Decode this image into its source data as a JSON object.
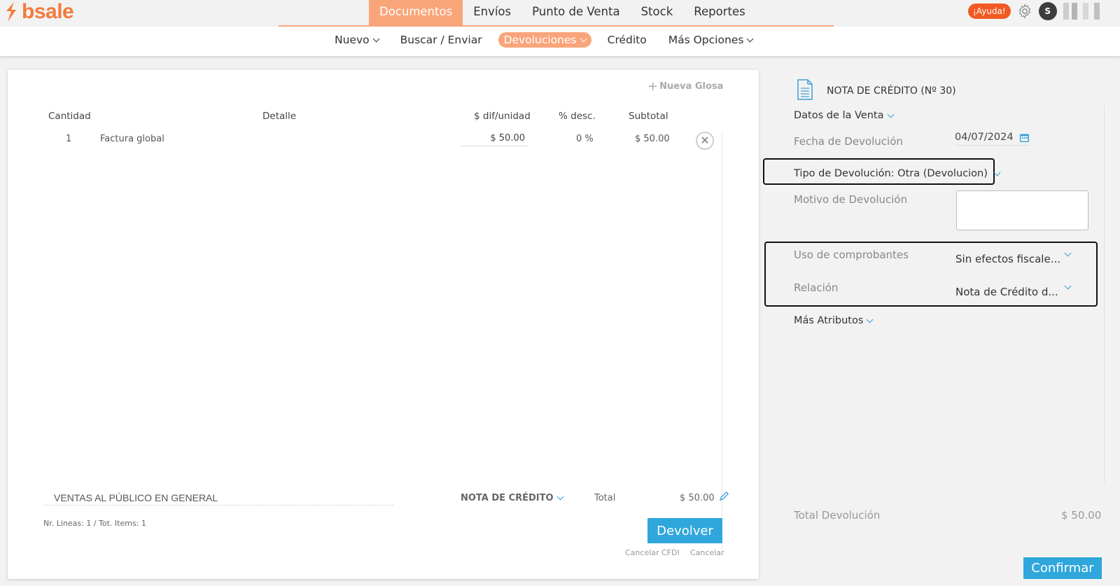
{
  "brand": {
    "name": "bsale",
    "color": "#f47b3b"
  },
  "main_nav": [
    {
      "label": "Documentos",
      "active": true
    },
    {
      "label": "Envíos"
    },
    {
      "label": "Punto de Venta"
    },
    {
      "label": "Stock"
    },
    {
      "label": "Reportes"
    }
  ],
  "top_right": {
    "help_label": "¡Ayuda!",
    "avatar_initial": "S"
  },
  "sub_nav": [
    {
      "label": "Nuevo",
      "dropdown": true
    },
    {
      "label": "Buscar / Enviar"
    },
    {
      "label": "Devoluciones",
      "dropdown": true,
      "active": true
    },
    {
      "label": "Crédito"
    },
    {
      "label": "Más Opciones",
      "dropdown": true
    }
  ],
  "editor": {
    "new_gloss_label": "Nueva Glosa",
    "columns": {
      "cantidad": "Cantidad",
      "detalle": "Detalle",
      "dif_unidad": "$ dif/unidad",
      "desc": "% desc.",
      "subtotal": "Subtotal"
    },
    "rows": [
      {
        "cantidad": "1",
        "detalle": "Factura global",
        "dif_unidad": "$ 50.00",
        "desc": "0 %",
        "subtotal": "$ 50.00"
      }
    ],
    "client_name": "VENTAS AL PÚBLICO  EN GENERAL",
    "doc_type": "NOTA DE CRÉDITO",
    "total_label": "Total",
    "total_value": "$ 50.00",
    "summary": "Nr. Lineas: 1 / Tot. Items: 1",
    "devolver_label": "Devolver",
    "cancel_cfdi_label": "Cancelar CFDI",
    "cancel_label": "Cancelar"
  },
  "sidebar": {
    "title": "NOTA DE CRÉDITO (Nº 30)",
    "datos_venta": "Datos de la Venta",
    "fecha_label": "Fecha de Devolución",
    "fecha_value": "04/07/2024",
    "tipo_label": "Tipo de Devolución: Otra (Devolucion)",
    "motivo_label": "Motivo de Devolución",
    "uso_label": "Uso de comprobantes",
    "uso_value": "Sin efectos fiscale...",
    "relacion_label": "Relación",
    "relacion_value": "Nota de Crédito d...",
    "mas_atributos": "Más Atributos",
    "total_label": "Total Devolución",
    "total_value": "$ 50.00",
    "confirm_label": "Confirmar"
  },
  "colors": {
    "accent_orange": "#f9a57a",
    "help_red": "#f05a22",
    "primary_blue": "#2fa7dc"
  }
}
